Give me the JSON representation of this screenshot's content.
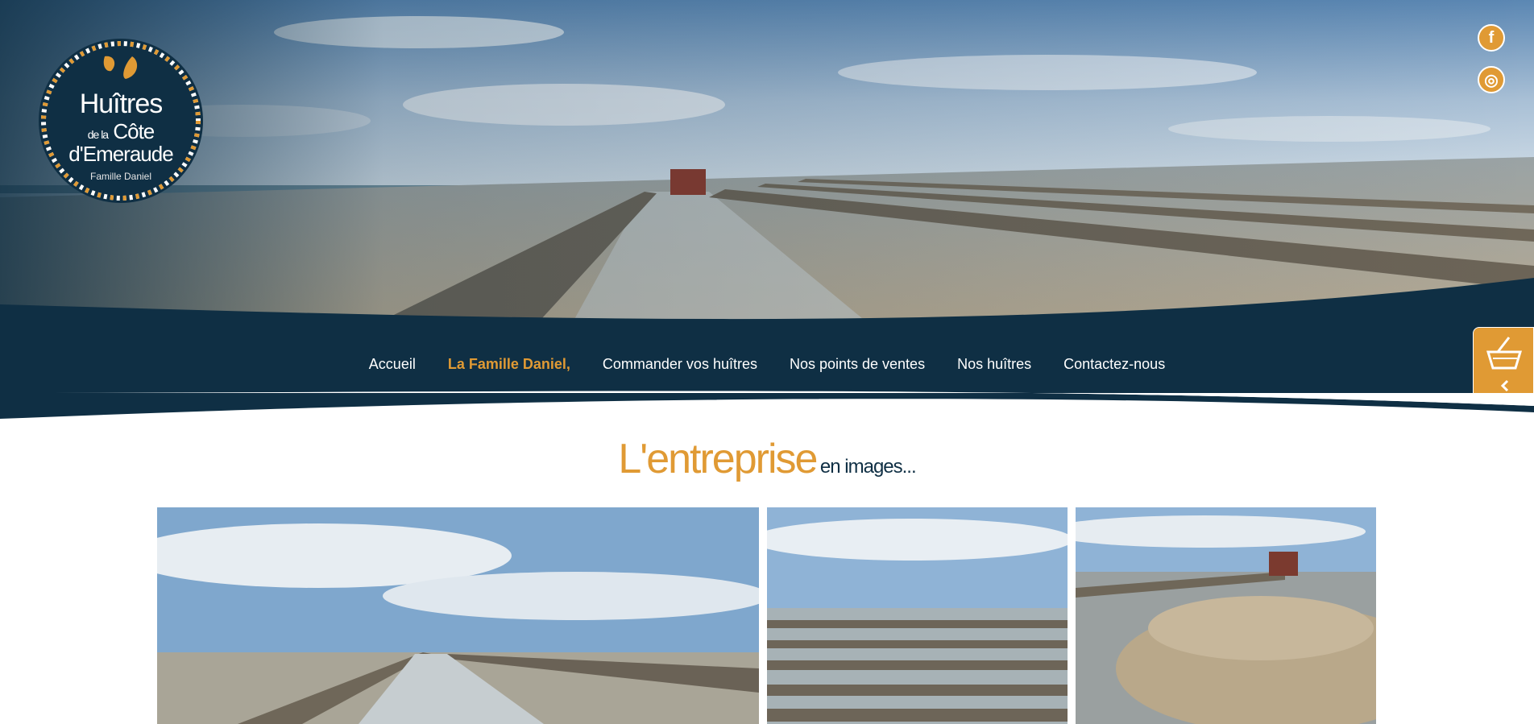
{
  "brand": {
    "line1": "Huîtres",
    "line2_small": "de la",
    "line2": "Côte",
    "line3": "d'Emeraude",
    "line4": "Famille Daniel"
  },
  "social": {
    "facebook_glyph": "f",
    "instagram_glyph": "◎",
    "icons": [
      "facebook-icon",
      "instagram-icon"
    ]
  },
  "nav": {
    "items": [
      {
        "label": "Accueil"
      },
      {
        "label": "La Famille Daniel,"
      },
      {
        "label": "Commander vos huîtres"
      },
      {
        "label": "Nos points de ventes"
      },
      {
        "label": "Nos huîtres"
      },
      {
        "label": "Contactez-nous"
      }
    ],
    "active_index": 1
  },
  "cart": {
    "icons": [
      "basket-icon",
      "chevron-left-icon"
    ]
  },
  "section": {
    "title_big": "L'entreprise",
    "title_small": "en images..."
  },
  "colors": {
    "navy": "#0f2f44",
    "orange": "#e09a34",
    "white": "#ffffff"
  }
}
